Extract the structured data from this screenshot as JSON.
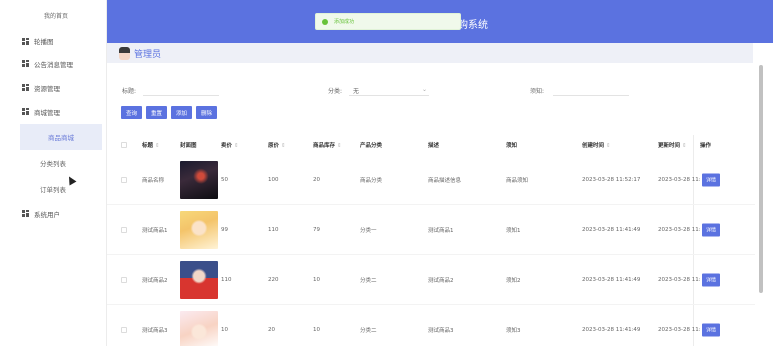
{
  "sidebar": {
    "home": "我的首页",
    "items": [
      {
        "label": "轮播图"
      },
      {
        "label": "公告消息管理"
      },
      {
        "label": "资源管理"
      },
      {
        "label": "商城管理"
      }
    ],
    "sub_items": [
      {
        "label": "商品商城",
        "active": true
      },
      {
        "label": "分类列表"
      },
      {
        "label": "订单列表"
      }
    ],
    "system": "系统用户"
  },
  "header": {
    "title": "购系统",
    "toast": "添加成功"
  },
  "subheader": {
    "title": "管理员"
  },
  "search": {
    "title_label": "标题:",
    "title_value": "",
    "category_label": "分类:",
    "category_value": "无",
    "notice_label": "须知:",
    "notice_value": ""
  },
  "buttons": {
    "search": "查询",
    "reset": "重置",
    "add": "添加",
    "delete": "删除"
  },
  "table": {
    "headers": {
      "title": "标题",
      "cover": "封面图",
      "price": "卖价",
      "orig_price": "原价",
      "stock": "商品库存",
      "category": "产品分类",
      "desc": "描述",
      "notice": "须知",
      "created": "创建时间",
      "updated": "更新时间",
      "ops": "操作"
    },
    "sort_glyph": "⇕",
    "detail_label": "详情",
    "rows": [
      {
        "title": "商品名称",
        "price": "50",
        "orig_price": "100",
        "stock": "20",
        "category": "商品分类",
        "desc": "商品描述信息",
        "notice": "商品须知",
        "created": "2023-03-28 11:52:17",
        "updated": "2023-03-28 11:",
        "img": "img1"
      },
      {
        "title": "测试商品1",
        "price": "99",
        "orig_price": "110",
        "stock": "79",
        "category": "分类一",
        "desc": "测试商品1",
        "notice": "须知1",
        "created": "2023-03-28 11:41:49",
        "updated": "2023-03-28 11:",
        "img": "img2"
      },
      {
        "title": "测试商品2",
        "price": "110",
        "orig_price": "220",
        "stock": "10",
        "category": "分类二",
        "desc": "测试商品2",
        "notice": "须知2",
        "created": "2023-03-28 11:41:49",
        "updated": "2023-03-28 11:",
        "img": "img3"
      },
      {
        "title": "测试商品3",
        "price": "10",
        "orig_price": "20",
        "stock": "10",
        "category": "分类二",
        "desc": "测试商品3",
        "notice": "须知3",
        "created": "2023-03-28 11:41:49",
        "updated": "2023-03-28 11:",
        "img": "img4"
      }
    ]
  },
  "colors": {
    "primary": "#5b72e0",
    "success": "#67c23a"
  }
}
